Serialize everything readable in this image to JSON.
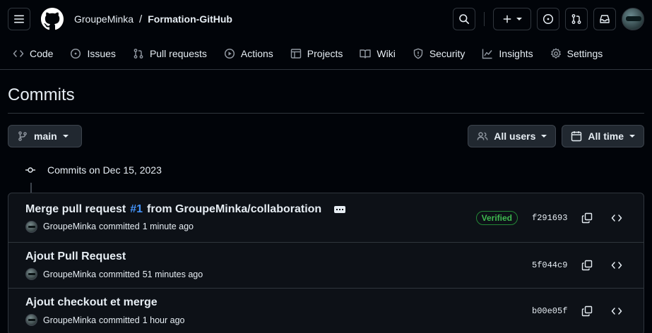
{
  "breadcrumb": {
    "owner": "GroupeMinka",
    "separator": "/",
    "repo": "Formation-GitHub"
  },
  "tabs": [
    {
      "label": "Code",
      "icon": "code-icon"
    },
    {
      "label": "Issues",
      "icon": "issue-opened-icon"
    },
    {
      "label": "Pull requests",
      "icon": "pull-request-icon"
    },
    {
      "label": "Actions",
      "icon": "play-icon"
    },
    {
      "label": "Projects",
      "icon": "table-icon"
    },
    {
      "label": "Wiki",
      "icon": "book-icon"
    },
    {
      "label": "Security",
      "icon": "shield-icon"
    },
    {
      "label": "Insights",
      "icon": "graph-icon"
    },
    {
      "label": "Settings",
      "icon": "gear-icon"
    }
  ],
  "page": {
    "title": "Commits"
  },
  "filters": {
    "branch": "main",
    "users": "All users",
    "time": "All time"
  },
  "group": {
    "label": "Commits on Dec 15, 2023"
  },
  "commits": [
    {
      "title_prefix": "Merge pull request",
      "pr": "#1",
      "title_suffix": "from GroupeMinka/collaboration",
      "author": "GroupeMinka",
      "action": "committed",
      "time": "1 minute ago",
      "verified": "Verified",
      "sha": "f291693"
    },
    {
      "title": "Ajout Pull Request",
      "author": "GroupeMinka",
      "action": "committed",
      "time": "51 minutes ago",
      "sha": "5f044c9"
    },
    {
      "title": "Ajout checkout et merge",
      "author": "GroupeMinka",
      "action": "committed",
      "time": "1 hour ago",
      "sha": "b00e05f"
    }
  ],
  "colors": {
    "background": "#010409",
    "border": "#30363d",
    "link": "#4493f8",
    "verified": "#3fb950"
  }
}
